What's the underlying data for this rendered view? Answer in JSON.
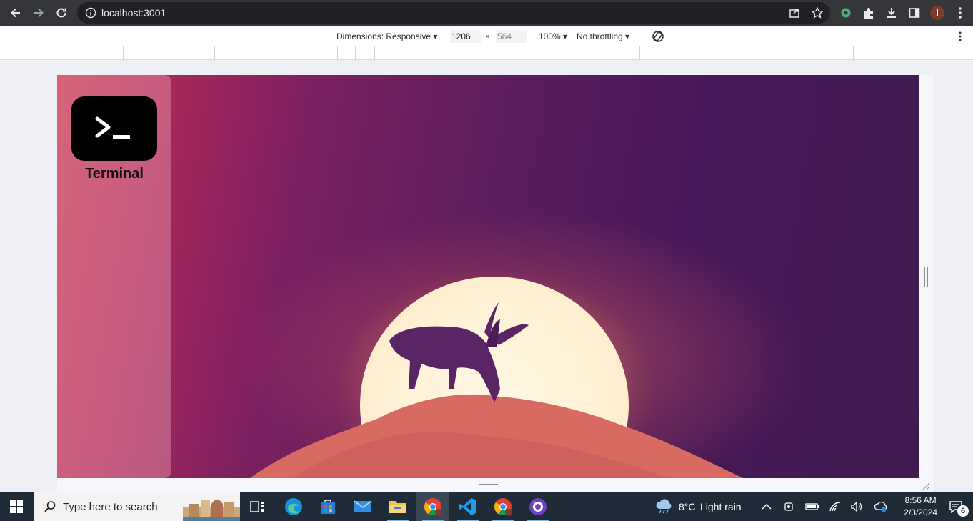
{
  "browser": {
    "url": "localhost:3001"
  },
  "devtools": {
    "dimensions_label": "Dimensions: Responsive",
    "width_value": "1206",
    "height_value": "564",
    "times": "×",
    "zoom": "100%",
    "throttling": "No throttling"
  },
  "desktop": {
    "apps": [
      {
        "label": "Terminal",
        "icon": "terminal-icon"
      }
    ]
  },
  "taskbar": {
    "search_placeholder": "Type here to search",
    "weather_temp": "8°C",
    "weather_desc": "Light rain",
    "time": "8:56 AM",
    "date": "2/3/2024",
    "notification_count": "6"
  }
}
